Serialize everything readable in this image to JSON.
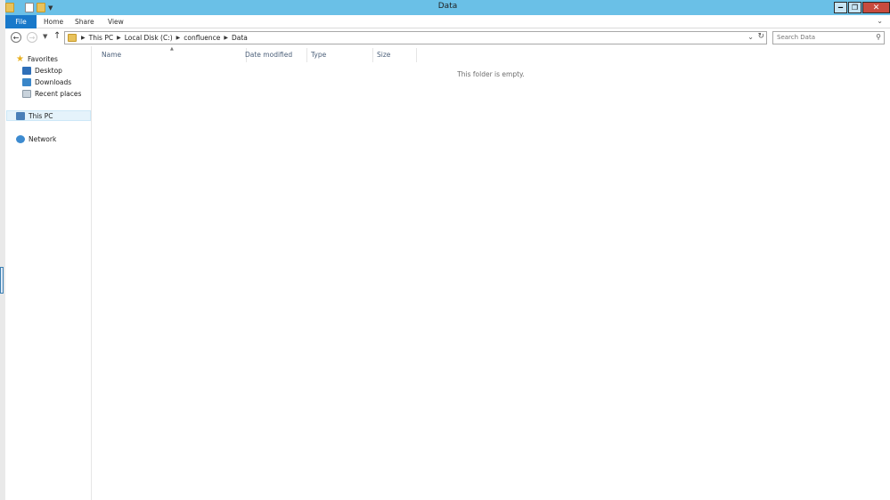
{
  "window": {
    "title": "Data"
  },
  "qat": {
    "icons": [
      "folder-icon",
      "properties-icon",
      "new-folder-icon",
      "customize-qat-icon"
    ]
  },
  "ribbon": {
    "tabs": [
      "File",
      "Home",
      "Share",
      "View"
    ]
  },
  "navigation": {
    "path": [
      "This PC",
      "Local Disk (C:)",
      "confluence",
      "Data"
    ],
    "search_placeholder": "Search Data"
  },
  "nav_pane": {
    "favorites_label": "Favorites",
    "favorites": [
      "Desktop",
      "Downloads",
      "Recent places"
    ],
    "this_pc_label": "This PC",
    "network_label": "Network"
  },
  "file_list": {
    "columns": [
      "Name",
      "Date modified",
      "Type",
      "Size"
    ],
    "empty_message": "This folder is empty."
  },
  "colors": {
    "titlebar": "#6ac0e7",
    "file_tab": "#1979ca",
    "close_button": "#c74b3e"
  }
}
